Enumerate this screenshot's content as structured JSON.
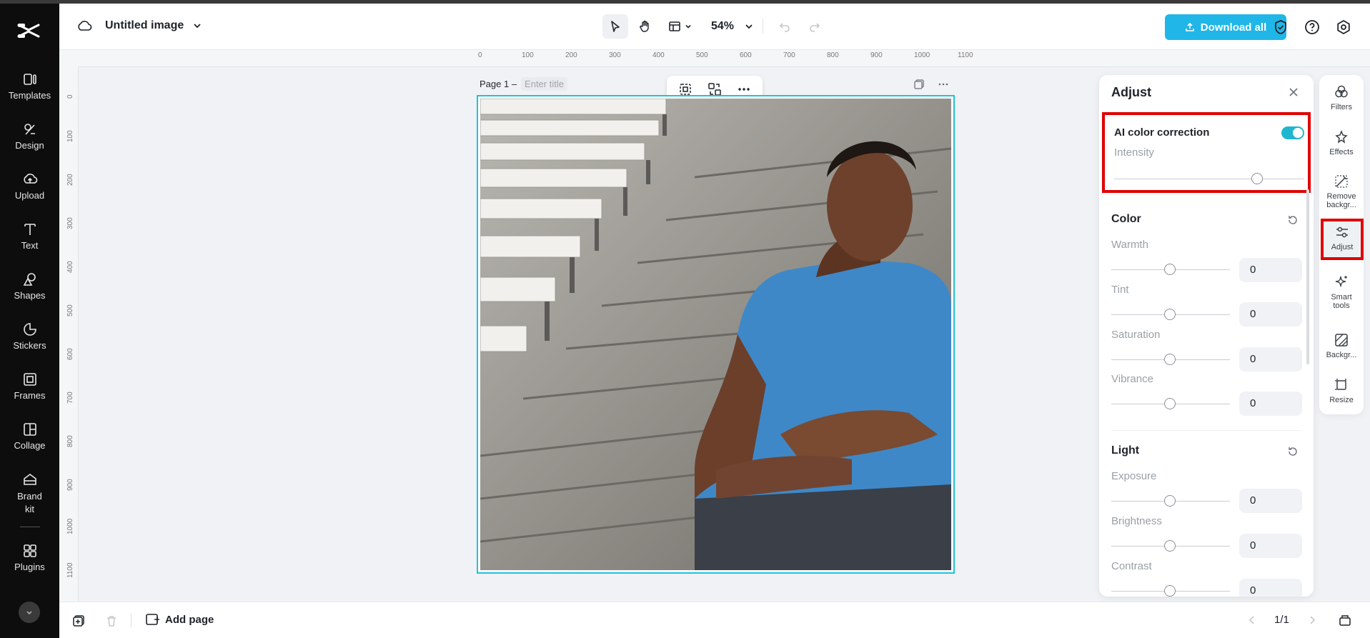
{
  "header": {
    "doc_title": "Untitled image",
    "zoom": "54%",
    "download_label": "Download all"
  },
  "sidebar": {
    "items": [
      {
        "label": "Templates",
        "icon": "templates-icon"
      },
      {
        "label": "Design",
        "icon": "design-icon"
      },
      {
        "label": "Upload",
        "icon": "upload-icon"
      },
      {
        "label": "Text",
        "icon": "text-icon"
      },
      {
        "label": "Shapes",
        "icon": "shapes-icon"
      },
      {
        "label": "Stickers",
        "icon": "stickers-icon"
      },
      {
        "label": "Frames",
        "icon": "frames-icon"
      },
      {
        "label": "Collage",
        "icon": "collage-icon"
      },
      {
        "label": "Brand kit",
        "icon": "brand-kit-icon"
      },
      {
        "label": "Plugins",
        "icon": "plugins-icon"
      }
    ]
  },
  "ruler": {
    "top": [
      "0",
      "100",
      "200",
      "300",
      "400",
      "500",
      "600",
      "700",
      "800",
      "900",
      "1000",
      "1100"
    ],
    "left": [
      "0",
      "100",
      "200",
      "300",
      "400",
      "500",
      "600",
      "700",
      "800",
      "900",
      "1000",
      "1100"
    ]
  },
  "page": {
    "label": "Page 1 –",
    "title_placeholder": "Enter title"
  },
  "adjust_panel": {
    "title": "Adjust",
    "ai_correction": {
      "label": "AI color correction",
      "enabled": true,
      "intensity_label": "Intensity",
      "intensity": 0.75
    },
    "color": {
      "title": "Color",
      "params": [
        {
          "label": "Warmth",
          "value": "0"
        },
        {
          "label": "Tint",
          "value": "0"
        },
        {
          "label": "Saturation",
          "value": "0"
        },
        {
          "label": "Vibrance",
          "value": "0"
        }
      ]
    },
    "light": {
      "title": "Light",
      "params": [
        {
          "label": "Exposure",
          "value": "0"
        },
        {
          "label": "Brightness",
          "value": "0"
        },
        {
          "label": "Contrast",
          "value": "0"
        }
      ]
    }
  },
  "tool_rail": {
    "items": [
      {
        "label": "Filters",
        "icon": "filters-icon"
      },
      {
        "label": "Effects",
        "icon": "effects-icon"
      },
      {
        "label": "Remove backgr...",
        "icon": "remove-background-icon"
      },
      {
        "label": "Adjust",
        "icon": "adjust-icon",
        "active": true
      },
      {
        "label": "Smart tools",
        "icon": "smart-tools-icon"
      },
      {
        "label": "Backgr...",
        "icon": "background-icon"
      },
      {
        "label": "Resize",
        "icon": "resize-icon"
      }
    ]
  },
  "bottom": {
    "add_page": "Add page",
    "pager": "1/1"
  },
  "colors": {
    "accent": "#20b6e8",
    "highlight": "#e00000",
    "selection": "#20c2d8"
  }
}
